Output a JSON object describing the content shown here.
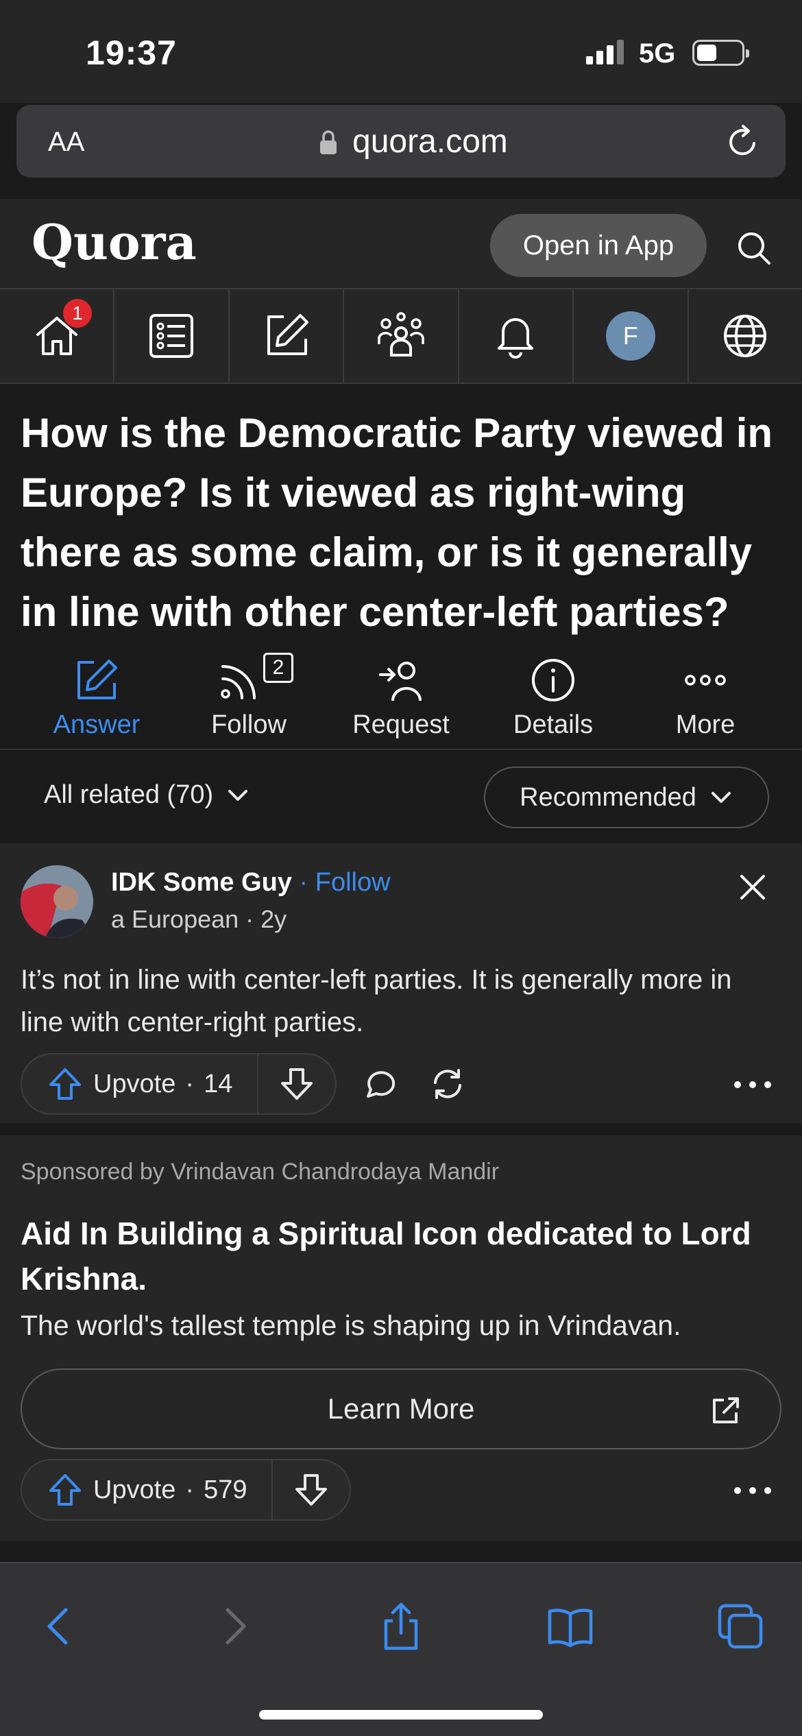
{
  "status": {
    "time": "19:37",
    "network": "5G",
    "battery_fraction": 0.45
  },
  "browser": {
    "text_size_label": "AA",
    "url": "quora.com"
  },
  "header": {
    "logo": "Quora",
    "open_in_app": "Open in App"
  },
  "nav": {
    "items": [
      {
        "icon": "home-icon",
        "badge": "1"
      },
      {
        "icon": "following-list-icon"
      },
      {
        "icon": "answer-pencil-icon"
      },
      {
        "icon": "spaces-people-icon"
      },
      {
        "icon": "bell-icon"
      },
      {
        "icon": "avatar",
        "avatar_letter": "F"
      },
      {
        "icon": "globe-icon"
      }
    ]
  },
  "question": {
    "title": "How is the Democratic Party viewed in Europe? Is it viewed as right-wing there as some claim, or is it generally in line with other center-left parties?",
    "actions": [
      {
        "label": "Answer",
        "icon": "pencil-icon",
        "active": true
      },
      {
        "label": "Follow",
        "icon": "follow-rss-icon",
        "count": "2"
      },
      {
        "label": "Request",
        "icon": "request-person-icon"
      },
      {
        "label": "Details",
        "icon": "info-icon"
      },
      {
        "label": "More",
        "icon": "more-dots-icon"
      }
    ]
  },
  "filters": {
    "all_related": "All related (70)",
    "sort": "Recommended"
  },
  "answer": {
    "author": "IDK Some Guy",
    "separator": " · ",
    "follow": "Follow",
    "meta": "a European · 2y",
    "text": "It’s not in line with center-left parties. It is generally more in line with center-right parties.",
    "upvote_label": "Upvote",
    "upvote_count": "14"
  },
  "ad": {
    "sponsor": "Sponsored by Vrindavan Chandrodaya Mandir",
    "title": "Aid In Building a Spiritual Icon dedicated to Lord Krishna.",
    "body": "The world's tallest temple is shaping up in Vrindavan.",
    "cta": "Learn More",
    "upvote_label": "Upvote",
    "upvote_count": "579"
  },
  "colors": {
    "accent": "#3c8cf0",
    "badge": "#e0272d",
    "card": "#262626",
    "background": "#1b1b1b"
  }
}
